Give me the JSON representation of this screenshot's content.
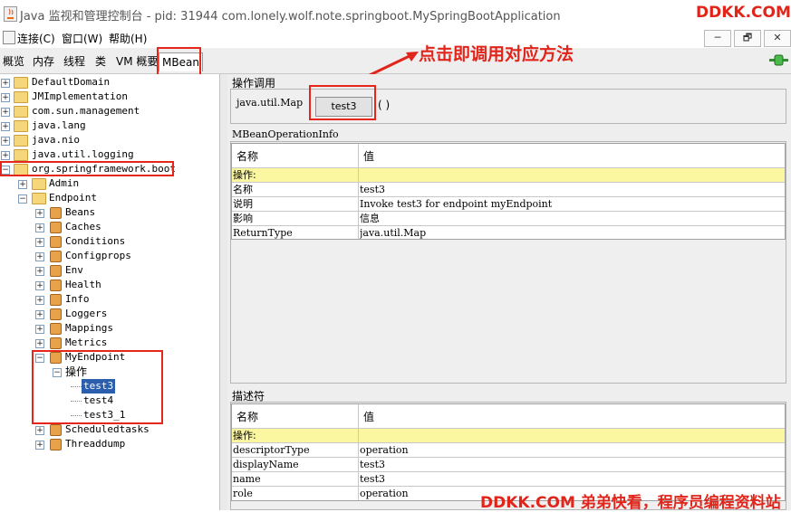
{
  "window": {
    "title": "Java 监视和管理控制台 - pid: 31944 com.lonely.wolf.note.springboot.MySpringBootApplication",
    "brand": "DDKK.COM",
    "controls": [
      "─",
      "🗗",
      "✕"
    ]
  },
  "menubar": [
    "连接(C)",
    "窗口(W)",
    "帮助(H)"
  ],
  "tabs": [
    "概览",
    "内存",
    "线程",
    "类",
    "VM 概要",
    "MBean"
  ],
  "annotation": "点击即调用对应方法",
  "tree": {
    "roots": [
      "DefaultDomain",
      "JMImplementation",
      "com.sun.management",
      "java.lang",
      "java.nio",
      "java.util.logging",
      "org.springframework.boot"
    ],
    "admin": "Admin",
    "endpoint": "Endpoint",
    "endpoint_children": [
      "Beans",
      "Caches",
      "Conditions",
      "Configprops",
      "Env",
      "Health",
      "Info",
      "Loggers",
      "Mappings",
      "Metrics"
    ],
    "my_endpoint": "MyEndpoint",
    "operations_label": "操作",
    "operations": [
      "test3",
      "test4",
      "test3_1"
    ],
    "tail": [
      "Scheduledtasks",
      "Threaddump"
    ]
  },
  "invoke": {
    "section_title": "操作调用",
    "return_type": "java.util.Map",
    "button": "test3",
    "params": "( )"
  },
  "op_info": {
    "section_title": "MBeanOperationInfo",
    "col_name": "名称",
    "col_value": "值",
    "group_row": "操作:",
    "rows": [
      {
        "name": "名称",
        "value": "test3"
      },
      {
        "name": "说明",
        "value": "Invoke test3 for endpoint myEndpoint"
      },
      {
        "name": "影响",
        "value": "信息"
      },
      {
        "name": "ReturnType",
        "value": "java.util.Map"
      }
    ]
  },
  "descriptor": {
    "section_title": "描述符",
    "col_name": "名称",
    "col_value": "值",
    "group_row": "操作:",
    "rows": [
      {
        "name": "descriptorType",
        "value": "operation"
      },
      {
        "name": "displayName",
        "value": "test3"
      },
      {
        "name": "name",
        "value": "test3"
      },
      {
        "name": "role",
        "value": "operation"
      }
    ]
  },
  "footer_brand": "DDKK.COM 弟弟快看，程序员编程资料站",
  "colors": {
    "accent_red": "#e1251b",
    "selection": "#2b5fad",
    "group_row": "#fbf6a0"
  }
}
